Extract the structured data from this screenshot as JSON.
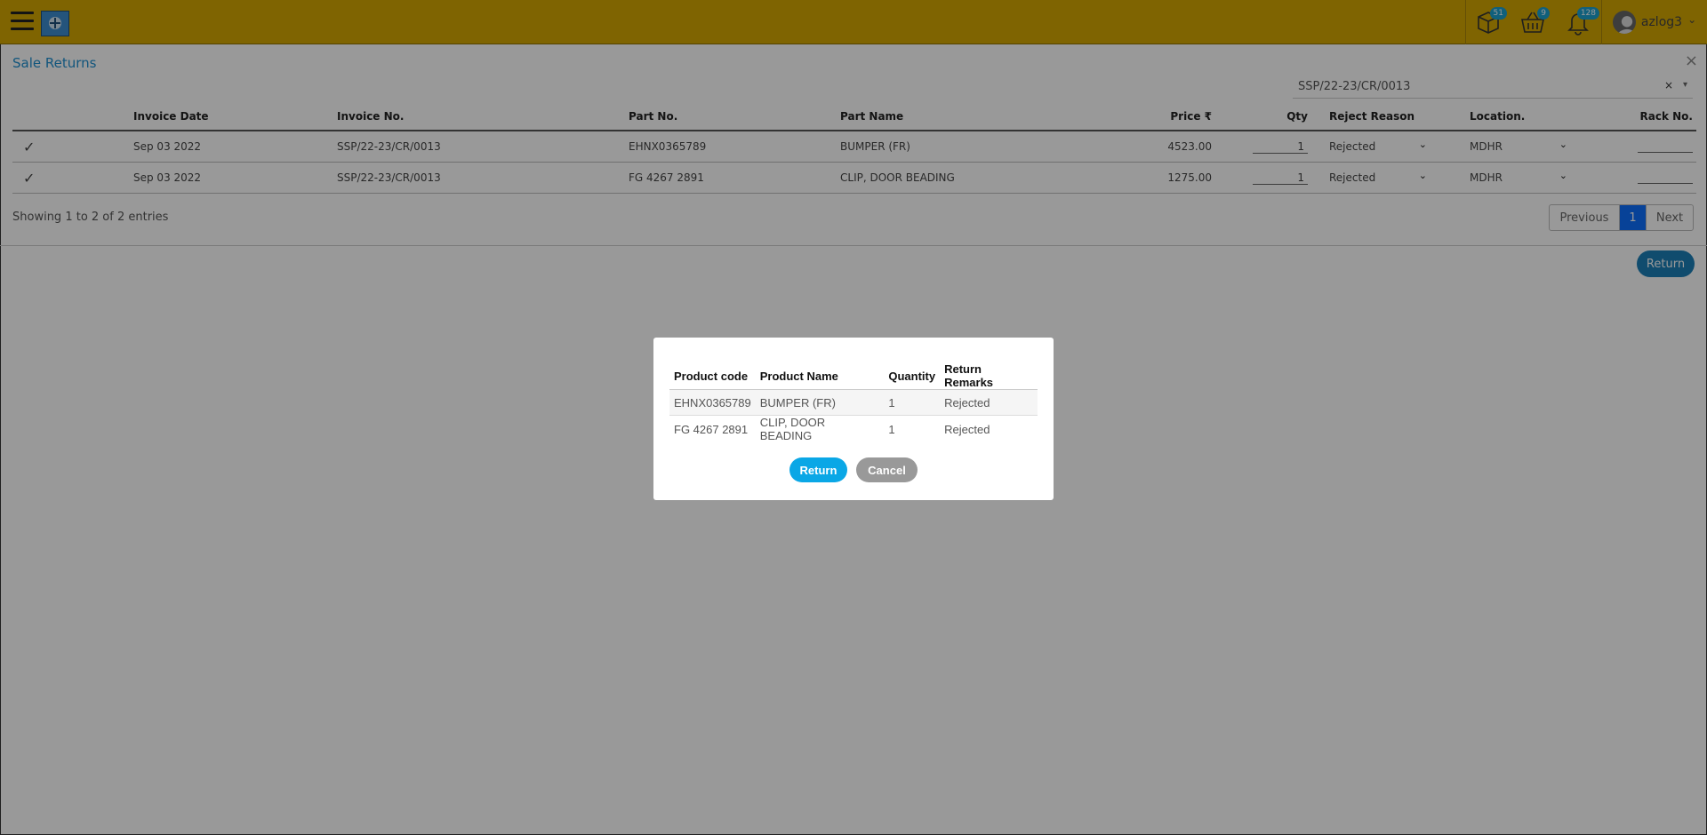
{
  "topbar": {
    "badges": {
      "packages": "51",
      "basket": "9",
      "bell": "128"
    },
    "user_name": "azlog3",
    "user_caret": "⌄"
  },
  "page": {
    "title": "Sale Returns",
    "close_glyph": "×",
    "search_value": "SSP/22-23/CR/0013",
    "clear_glyph": "×",
    "caret_glyph": "▾"
  },
  "table": {
    "headers": {
      "invoice_date": "Invoice Date",
      "invoice_no": "Invoice No.",
      "part_no": "Part No.",
      "part_name": "Part Name",
      "price": "Price ₹",
      "qty": "Qty",
      "reject_reason": "Reject Reason",
      "location": "Location.",
      "rack_no": "Rack No."
    },
    "rows": [
      {
        "check": "✓",
        "invoice_date": "Sep 03 2022",
        "invoice_no": "SSP/22-23/CR/0013",
        "part_no": "EHNX0365789",
        "part_name": "BUMPER (FR)",
        "price": "4523.00",
        "qty": "1",
        "reject_reason": "Rejected",
        "location": "MDHR"
      },
      {
        "check": "✓",
        "invoice_date": "Sep 03 2022",
        "invoice_no": "SSP/22-23/CR/0013",
        "part_no": "FG 4267 2891",
        "part_name": "CLIP, DOOR BEADING",
        "price": "1275.00",
        "qty": "1",
        "reject_reason": "Rejected",
        "location": "MDHR"
      }
    ],
    "select_chevron": "⌄",
    "showing": "Showing 1 to 2 of 2 entries",
    "pager": {
      "previous": "Previous",
      "current": "1",
      "next": "Next"
    },
    "return_label": "Return"
  },
  "modal": {
    "headers": {
      "code": "Product code",
      "name": "Product Name",
      "qty": "Quantity",
      "remarks": "Return Remarks"
    },
    "rows": [
      {
        "code": "EHNX0365789",
        "name": "BUMPER (FR)",
        "qty": "1",
        "remarks": "Rejected"
      },
      {
        "code": "FG 4267 2891",
        "name": "CLIP, DOOR BEADING",
        "qty": "1",
        "remarks": "Rejected"
      }
    ],
    "return_label": "Return",
    "cancel_label": "Cancel"
  },
  "colors": {
    "topbar": "#d4a703",
    "accent": "#1f8fd0",
    "modal_return": "#0aa7e6",
    "modal_cancel": "#999999"
  },
  "icons": [
    "hamburger-icon",
    "logo-icon",
    "package-icon",
    "basket-icon",
    "bell-icon",
    "avatar-icon",
    "check-icon",
    "chevron-down-icon",
    "close-icon"
  ]
}
